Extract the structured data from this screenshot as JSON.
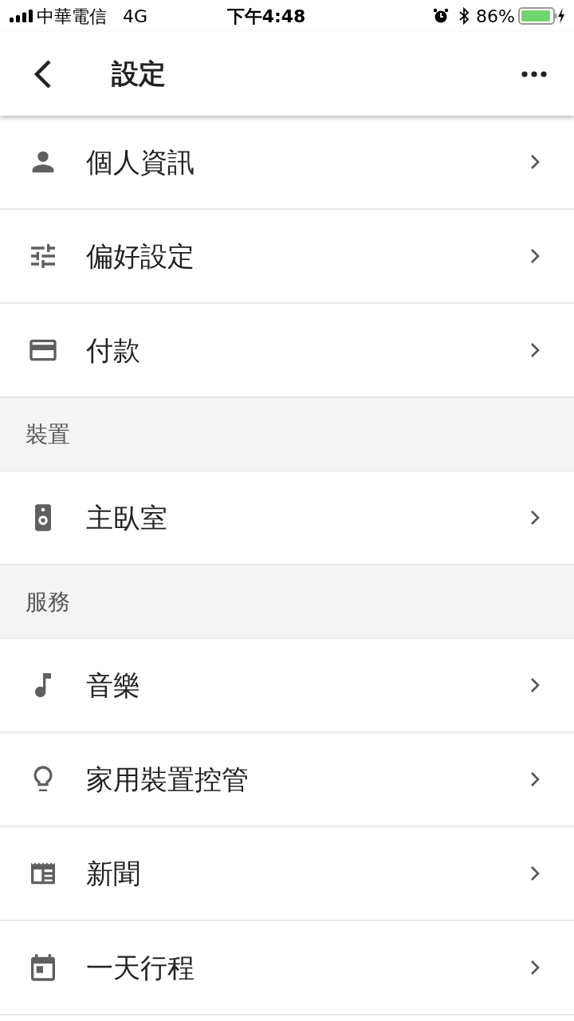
{
  "status_bar": {
    "carrier": "中華電信",
    "network": "4G",
    "time": "下午4:48",
    "battery": "86%"
  },
  "header": {
    "title": "設定"
  },
  "list": [
    {
      "kind": "item",
      "label": "個人資訊"
    },
    {
      "kind": "item",
      "label": "偏好設定"
    },
    {
      "kind": "item",
      "label": "付款"
    },
    {
      "kind": "section",
      "label": "裝置"
    },
    {
      "kind": "item",
      "label": "主臥室"
    },
    {
      "kind": "section",
      "label": "服務"
    },
    {
      "kind": "item",
      "label": "音樂"
    },
    {
      "kind": "item",
      "label": "家用裝置控管"
    },
    {
      "kind": "item",
      "label": "新聞"
    },
    {
      "kind": "item",
      "label": "一天行程"
    }
  ]
}
